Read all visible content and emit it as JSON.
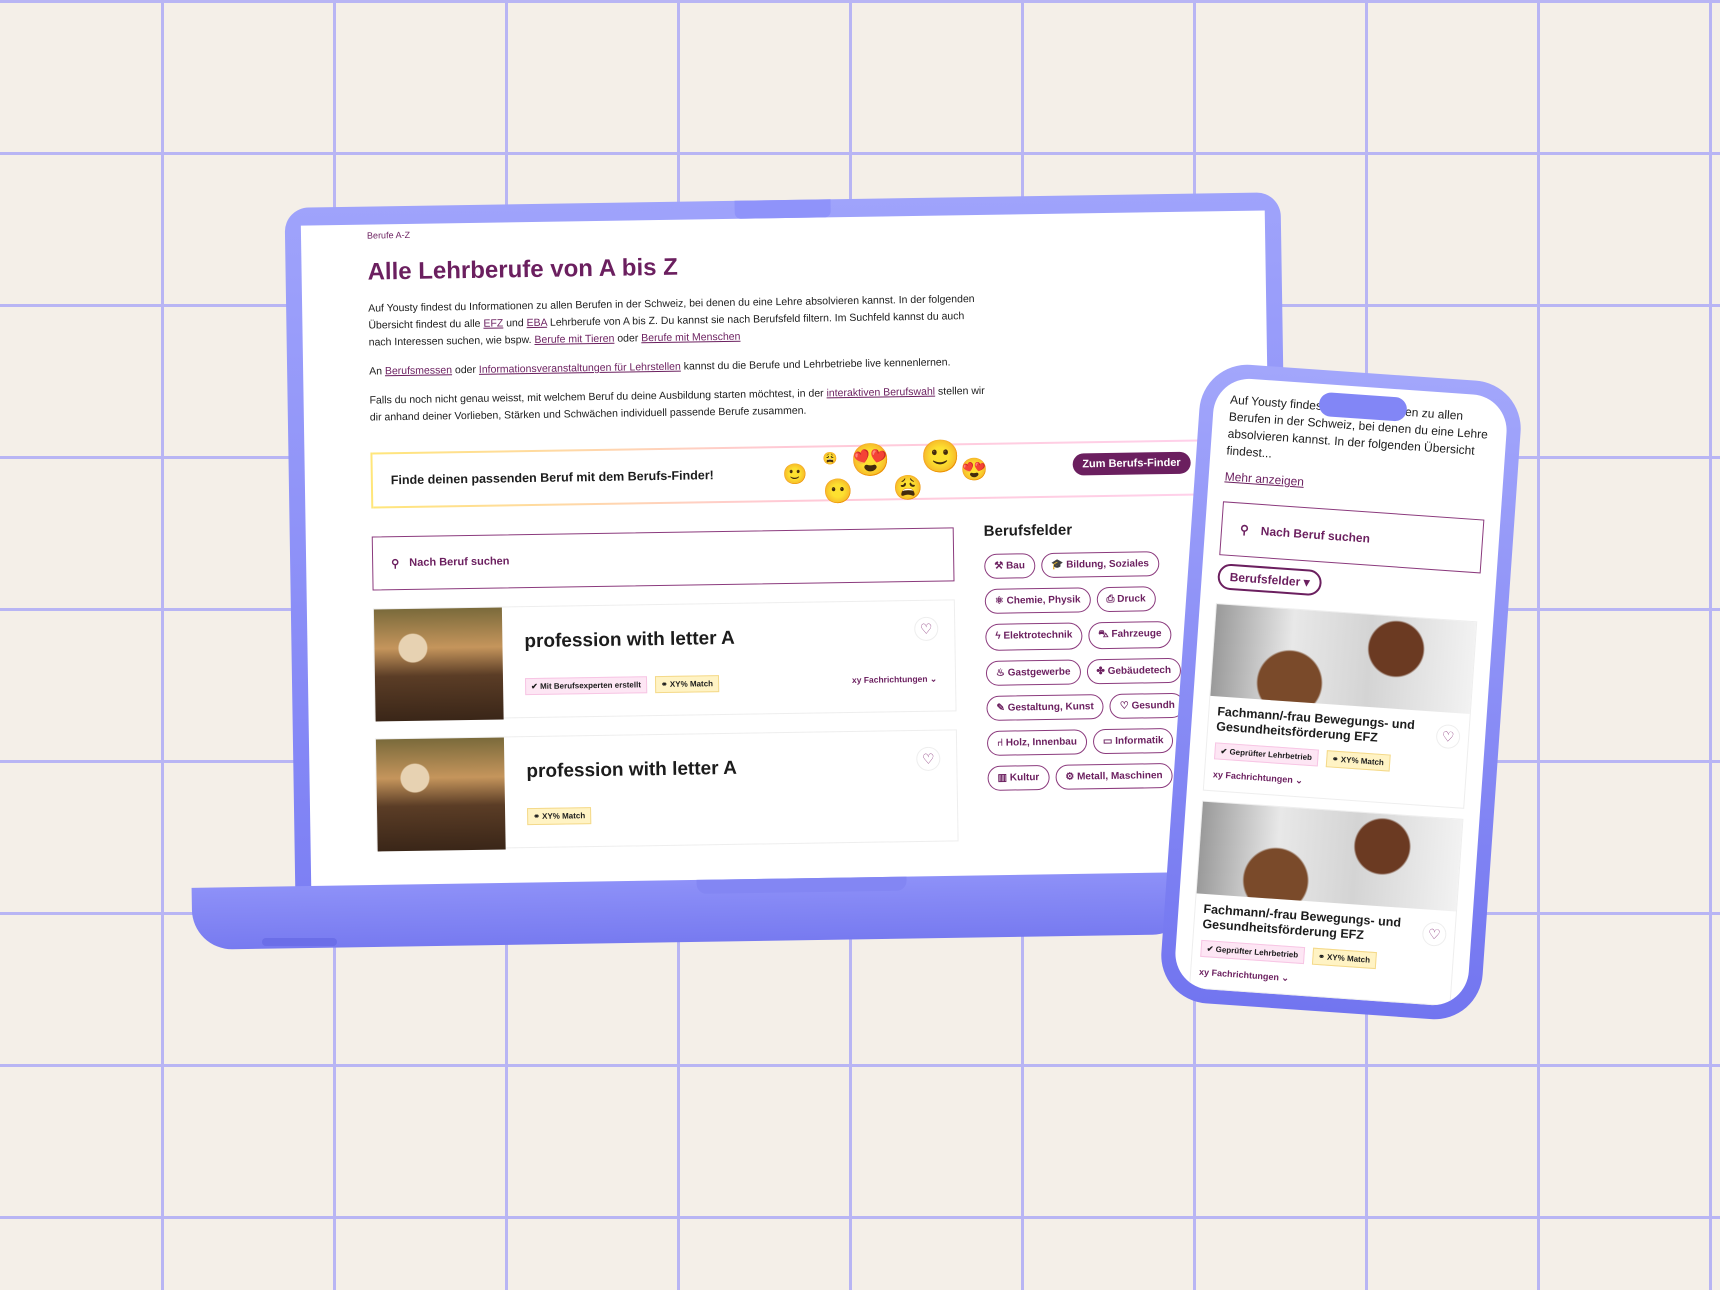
{
  "laptop": {
    "breadcrumb": "Berufe A-Z",
    "title": "Alle Lehrberufe von A bis Z",
    "intro": {
      "p1_a": "Auf Yousty findest du Informationen zu allen Berufen in der Schweiz, bei denen du eine Lehre absolvieren kannst. In der folgenden Übersicht findest du alle ",
      "link_efz": "EFZ",
      "p1_b": " und ",
      "link_eba": "EBA",
      "p1_c": " Lehrberufe von A bis Z. Du kannst sie nach Berufsfeld filtern. Im Suchfeld kannst du auch nach Interessen suchen, wie bspw. ",
      "link_tiere": "Berufe mit Tieren",
      "p1_d": " oder ",
      "link_menschen": "Berufe mit Menschen",
      "p2_a": "An ",
      "link_messen": "Berufsmessen",
      "p2_b": " oder ",
      "link_info": "Informationsveranstaltungen für Lehrstellen",
      "p2_c": " kannst du die Berufe und Lehrbetriebe live kennenlernen.",
      "p3_a": "Falls du noch nicht genau weisst, mit welchem Beruf du deine Ausbildung starten möchtest, in der ",
      "link_berufswahl": "interaktiven Berufswahl",
      "p3_b": " stellen wir dir anhand deiner Vorlieben, Stärken und Schwächen individuell passende Berufe zusammen."
    },
    "banner": {
      "text": "Finde deinen passenden Beruf mit dem Berufs-Finder!",
      "button": "Zum Berufs-Finder"
    },
    "search_placeholder": "Nach Beruf suchen",
    "cards": [
      {
        "title": "profession with letter A",
        "badge": "Mit Berufsexperten erstellt",
        "match": "XY% Match",
        "fachrichtungen": "xy Fachrichtungen"
      },
      {
        "title": "profession with letter A",
        "match": "XY% Match"
      }
    ],
    "berufsfelder_title": "Berufsfelder",
    "berufsfelder": [
      {
        "label": "Bau",
        "icon": "hammer"
      },
      {
        "label": "Bildung, Soziales",
        "icon": "graduation-cap"
      },
      {
        "label": "Chemie, Physik",
        "icon": "atom"
      },
      {
        "label": "Druck",
        "icon": "printer"
      },
      {
        "label": "Elektrotechnik",
        "icon": "lightning"
      },
      {
        "label": "Fahrzeuge",
        "icon": "car"
      },
      {
        "label": "Gastgewerbe",
        "icon": "pot"
      },
      {
        "label": "Gebäudetech",
        "icon": "fan"
      },
      {
        "label": "Gestaltung, Kunst",
        "icon": "brush"
      },
      {
        "label": "Gesundh",
        "icon": "heart"
      },
      {
        "label": "Holz, Innenbau",
        "icon": "chair"
      },
      {
        "label": "Informatik",
        "icon": "laptop"
      },
      {
        "label": "Kultur",
        "icon": "books"
      },
      {
        "label": "Metall, Maschinen",
        "icon": "gear"
      }
    ]
  },
  "phone": {
    "intro": "Auf Yousty findest du Informationen zu allen Berufen in der Schweiz, bei denen du eine Lehre absolvieren kannst. In der folgenden Übersicht findest...",
    "more": "Mehr anzeigen",
    "search_placeholder": "Nach Beruf suchen",
    "filter": "Berufsfelder",
    "cards": [
      {
        "title": "Fachmann/-frau Bewegungs- und Gesundheitsförderung EFZ",
        "badge": "Geprüfter Lehrbetrieb",
        "match": "XY% Match",
        "fachrichtungen": "xy Fachrichtungen"
      },
      {
        "title": "Fachmann/-frau Bewegungs- und Gesundheitsförderung EFZ",
        "badge": "Geprüfter Lehrbetrieb",
        "match": "XY% Match",
        "fachrichtungen": "xy Fachrichtungen"
      }
    ]
  },
  "colors": {
    "brand": "#6b1f5f",
    "device": "#8a8df7",
    "background": "#f4efe8",
    "grid": "#b8b5f4"
  }
}
